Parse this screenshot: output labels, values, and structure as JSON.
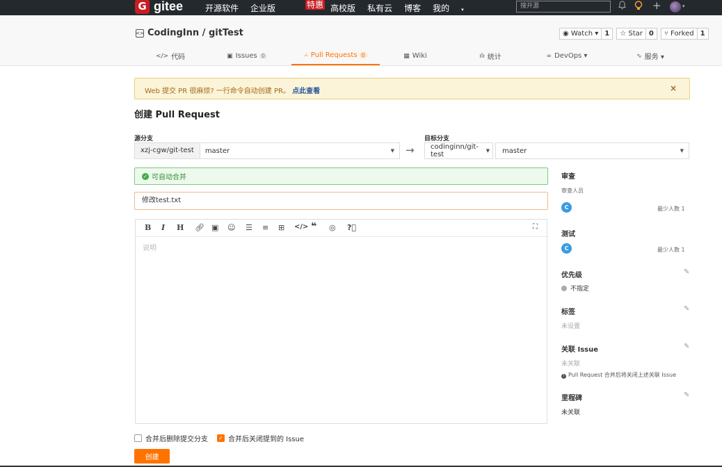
{
  "nav": {
    "logo_letter": "G",
    "logo_text": "gitee",
    "links": [
      "开源软件",
      "企业版",
      "高校版",
      "私有云",
      "博客",
      "我的"
    ],
    "hot_badge": "特惠",
    "search_placeholder": "搜开源"
  },
  "project": {
    "title": "CodingInn / gitTest",
    "watch_label": "Watch ▾",
    "watch_count": "1",
    "star_label": "Star",
    "star_count": "0",
    "fork_label": "Forked",
    "fork_count": "1"
  },
  "tabs": [
    {
      "label": "代码",
      "count": ""
    },
    {
      "label": "Issues",
      "count": "0"
    },
    {
      "label": "Pull Requests",
      "count": "0"
    },
    {
      "label": "Wiki",
      "count": ""
    },
    {
      "label": "统计",
      "count": ""
    },
    {
      "label": "DevOps ▾",
      "count": ""
    },
    {
      "label": "服务 ▾",
      "count": ""
    }
  ],
  "banner": {
    "text": "Web 提交 PR 很麻烦? 一行命令自动创建 PR。",
    "link": "点此查看",
    "close": "×"
  },
  "page_title": "创建 Pull Request",
  "source": {
    "label": "源分支",
    "repo": "xzj-cgw/git-test",
    "branch": "master"
  },
  "target": {
    "label": "目标分支",
    "repo": "codinginn/git-test",
    "branch": "master"
  },
  "merge_status": "可自动合并",
  "pr_title": "修改test.txt",
  "editor_placeholder": "说明",
  "options": {
    "delete_branch": "合并后删除提交分支",
    "delete_branch_checked": false,
    "close_issue": "合并后关闭提到的 Issue",
    "close_issue_checked": true
  },
  "create_button": "创建",
  "sidebar": {
    "review_title": "审查",
    "reviewers_label": "审查人员",
    "reviewer_avatar": "C",
    "reviewer_min": "最少人数 1",
    "test_title": "测试",
    "tester_avatar": "C",
    "tester_min": "最少人数 1",
    "priority_title": "优先级",
    "priority_value": "不指定",
    "labels_title": "标签",
    "labels_value": "未设置",
    "issue_title": "关联 Issue",
    "issue_value": "未关联",
    "issue_note": "Pull Request 合并后将关闭上述关联 Issue",
    "milestone_title": "里程碑",
    "milestone_value": "未关联"
  },
  "colors": {
    "accent": "#fe7300",
    "nav_bg": "#24292e",
    "success": "#3cb043",
    "brand_red": "#c71d23"
  }
}
